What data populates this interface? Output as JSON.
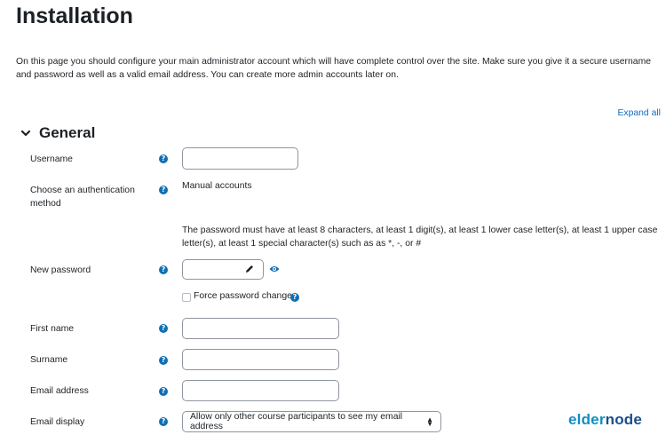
{
  "page": {
    "title": "Installation",
    "intro": "On this page you should configure your main administrator account which will have complete control over the site. Make sure you give it a secure username and password as well as a valid email address. You can create more admin accounts later on.",
    "expand_all": "Expand all"
  },
  "section": {
    "title": "General",
    "icon": "chevron-down-icon"
  },
  "fields": {
    "username": {
      "label": "Username",
      "value": ""
    },
    "auth": {
      "label": "Choose an authentication method",
      "value": "Manual accounts"
    },
    "password_hint": "The password must have at least 8 characters, at least 1 digit(s), at least 1 lower case letter(s), at least 1 upper case letter(s), at least 1 special character(s) such as as *, -, or #",
    "new_password": {
      "label": "New password",
      "value": ""
    },
    "force_change": {
      "label": "Force password change",
      "checked": false
    },
    "first_name": {
      "label": "First name",
      "value": ""
    },
    "surname": {
      "label": "Surname",
      "value": ""
    },
    "email": {
      "label": "Email address",
      "value": ""
    },
    "email_display": {
      "label": "Email display",
      "value": "Allow only other course participants to see my email address"
    }
  },
  "help_glyph": "?",
  "watermark": {
    "part1": "elder",
    "part2": "node"
  },
  "colors": {
    "link": "#0f6cbf",
    "help": "#0f6fb4",
    "border": "#8f959e",
    "logo_light": "#0f8fc4",
    "logo_dark": "#1a4e8a"
  }
}
